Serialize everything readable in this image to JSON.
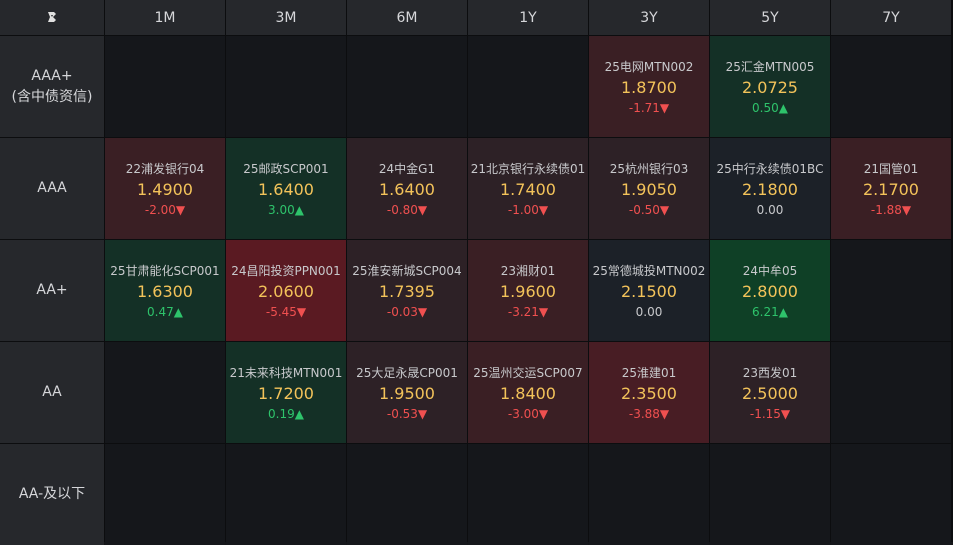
{
  "corner_icon": "logo-icon",
  "columns": [
    "1M",
    "3M",
    "6M",
    "1Y",
    "3Y",
    "5Y",
    "7Y"
  ],
  "rows": [
    {
      "label": "AAA+\n(含中债资信)",
      "cells": [
        null,
        null,
        null,
        null,
        {
          "name": "25电网MTN002",
          "value": "1.8700",
          "change": "-1.71▼",
          "dir": "dn",
          "tone": "red1"
        },
        {
          "name": "25汇金MTN005",
          "value": "2.0725",
          "change": "0.50▲",
          "dir": "up",
          "tone": "grn1"
        },
        null
      ]
    },
    {
      "label": "AAA",
      "cells": [
        {
          "name": "22浦发银行04",
          "value": "1.4900",
          "change": "-2.00▼",
          "dir": "dn",
          "tone": "red1"
        },
        {
          "name": "25邮政SCP001",
          "value": "1.6400",
          "change": "3.00▲",
          "dir": "up",
          "tone": "grn1"
        },
        {
          "name": "24中金G1",
          "value": "1.6400",
          "change": "-0.80▼",
          "dir": "dn",
          "tone": "redd"
        },
        {
          "name": "21北京银行永续债01",
          "value": "1.7400",
          "change": "-1.00▼",
          "dir": "dn",
          "tone": "redd"
        },
        {
          "name": "25杭州银行03",
          "value": "1.9050",
          "change": "-0.50▼",
          "dir": "dn",
          "tone": "redd"
        },
        {
          "name": "25中行永续债01BC",
          "value": "2.1800",
          "change": "0.00",
          "dir": "flat",
          "tone": "neu"
        },
        {
          "name": "21国管01",
          "value": "2.1700",
          "change": "-1.88▼",
          "dir": "dn",
          "tone": "red1"
        }
      ]
    },
    {
      "label": "AA+",
      "cells": [
        {
          "name": "25甘肃能化SCP001",
          "value": "1.6300",
          "change": "0.47▲",
          "dir": "up",
          "tone": "grn1"
        },
        {
          "name": "24昌阳投资PPN001",
          "value": "2.0600",
          "change": "-5.45▼",
          "dir": "dn",
          "tone": "red3"
        },
        {
          "name": "25淮安新城SCP004",
          "value": "1.7395",
          "change": "-0.03▼",
          "dir": "dn",
          "tone": "redd"
        },
        {
          "name": "23湘财01",
          "value": "1.9600",
          "change": "-3.21▼",
          "dir": "dn",
          "tone": "red1"
        },
        {
          "name": "25常德城投MTN002",
          "value": "2.1500",
          "change": "0.00",
          "dir": "flat",
          "tone": "neu"
        },
        {
          "name": "24中牟05",
          "value": "2.8000",
          "change": "6.21▲",
          "dir": "up",
          "tone": "grn2"
        },
        null
      ]
    },
    {
      "label": "AA",
      "cells": [
        null,
        {
          "name": "21未来科技MTN001",
          "value": "1.7200",
          "change": "0.19▲",
          "dir": "up",
          "tone": "grn1"
        },
        {
          "name": "25大足永晟CP001",
          "value": "1.9500",
          "change": "-0.53▼",
          "dir": "dn",
          "tone": "redd"
        },
        {
          "name": "25温州交运SCP007",
          "value": "1.8400",
          "change": "-3.00▼",
          "dir": "dn",
          "tone": "red1"
        },
        {
          "name": "25淮建01",
          "value": "2.3500",
          "change": "-3.88▼",
          "dir": "dn",
          "tone": "red2"
        },
        {
          "name": "23西发01",
          "value": "2.5000",
          "change": "-1.15▼",
          "dir": "dn",
          "tone": "redd"
        },
        null
      ]
    },
    {
      "label": "AA-及以下",
      "cells": [
        null,
        null,
        null,
        null,
        null,
        null,
        null
      ]
    }
  ]
}
